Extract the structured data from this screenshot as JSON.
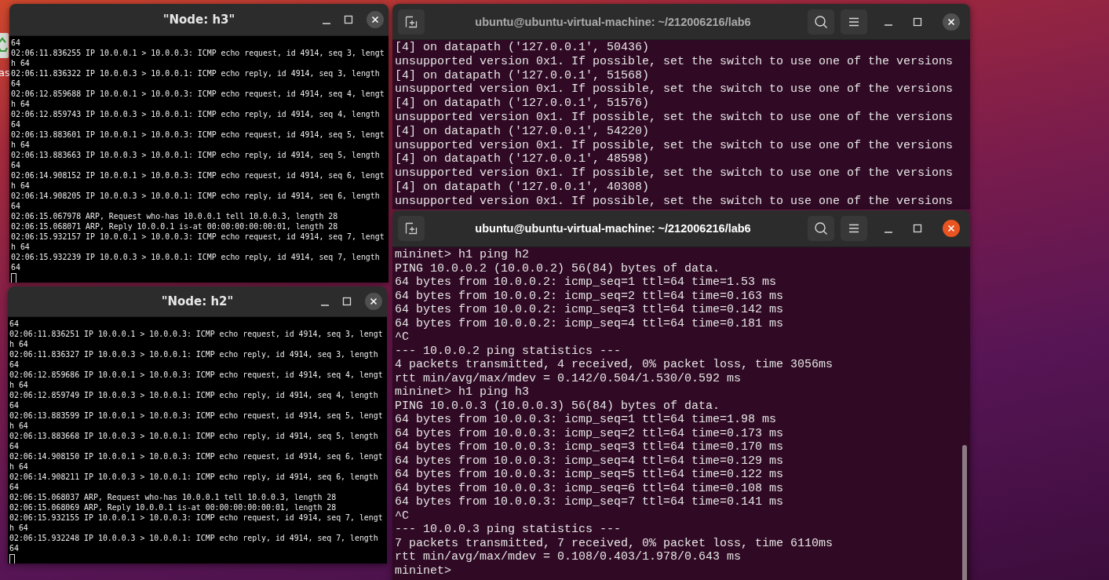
{
  "desktop": {
    "icon_label": "as"
  },
  "windows": [
    {
      "kind": "xterm",
      "title": "\"Node: h3\"",
      "active": false,
      "lines": [
        "64",
        "02:06:11.836255 IP 10.0.0.1 > 10.0.0.3: ICMP echo request, id 4914, seq 3, lengt",
        "h 64",
        "02:06:11.836322 IP 10.0.0.3 > 10.0.0.1: ICMP echo reply, id 4914, seq 3, length",
        "64",
        "02:06:12.859688 IP 10.0.0.1 > 10.0.0.3: ICMP echo request, id 4914, seq 4, lengt",
        "h 64",
        "02:06:12.859743 IP 10.0.0.3 > 10.0.0.1: ICMP echo reply, id 4914, seq 4, length",
        "64",
        "02:06:13.883601 IP 10.0.0.1 > 10.0.0.3: ICMP echo request, id 4914, seq 5, lengt",
        "h 64",
        "02:06:13.883663 IP 10.0.0.3 > 10.0.0.1: ICMP echo reply, id 4914, seq 5, length",
        "64",
        "02:06:14.908152 IP 10.0.0.1 > 10.0.0.3: ICMP echo request, id 4914, seq 6, lengt",
        "h 64",
        "02:06:14.908205 IP 10.0.0.3 > 10.0.0.1: ICMP echo reply, id 4914, seq 6, length",
        "64",
        "02:06:15.067978 ARP, Request who-has 10.0.0.1 tell 10.0.0.3, length 28",
        "02:06:15.068071 ARP, Reply 10.0.0.1 is-at 00:00:00:00:00:01, length 28",
        "02:06:15.932157 IP 10.0.0.1 > 10.0.0.3: ICMP echo request, id 4914, seq 7, lengt",
        "h 64",
        "02:06:15.932239 IP 10.0.0.3 > 10.0.0.1: ICMP echo reply, id 4914, seq 7, length",
        "64"
      ]
    },
    {
      "kind": "gnome",
      "title": "ubuntu@ubuntu-virtual-machine: ~/212006216/lab6",
      "active": false,
      "lines": [
        "[4] on datapath ('127.0.0.1', 50436)",
        "unsupported version 0x1. If possible, set the switch to use one of the versions",
        "[4] on datapath ('127.0.0.1', 51568)",
        "unsupported version 0x1. If possible, set the switch to use one of the versions",
        "[4] on datapath ('127.0.0.1', 51576)",
        "unsupported version 0x1. If possible, set the switch to use one of the versions",
        "[4] on datapath ('127.0.0.1', 54220)",
        "unsupported version 0x1. If possible, set the switch to use one of the versions",
        "[4] on datapath ('127.0.0.1', 48598)",
        "unsupported version 0x1. If possible, set the switch to use one of the versions",
        "[4] on datapath ('127.0.0.1', 40308)",
        "unsupported version 0x1. If possible, set the switch to use one of the versions"
      ]
    },
    {
      "kind": "gnome",
      "title": "ubuntu@ubuntu-virtual-machine: ~/212006216/lab6",
      "active": true,
      "lines": [
        "mininet> h1 ping h2",
        "PING 10.0.0.2 (10.0.0.2) 56(84) bytes of data.",
        "64 bytes from 10.0.0.2: icmp_seq=1 ttl=64 time=1.53 ms",
        "64 bytes from 10.0.0.2: icmp_seq=2 ttl=64 time=0.163 ms",
        "64 bytes from 10.0.0.2: icmp_seq=3 ttl=64 time=0.142 ms",
        "64 bytes from 10.0.0.2: icmp_seq=4 ttl=64 time=0.181 ms",
        "^C",
        "--- 10.0.0.2 ping statistics ---",
        "4 packets transmitted, 4 received, 0% packet loss, time 3056ms",
        "rtt min/avg/max/mdev = 0.142/0.504/1.530/0.592 ms",
        "mininet> h1 ping h3",
        "PING 10.0.0.3 (10.0.0.3) 56(84) bytes of data.",
        "64 bytes from 10.0.0.3: icmp_seq=1 ttl=64 time=1.98 ms",
        "64 bytes from 10.0.0.3: icmp_seq=2 ttl=64 time=0.173 ms",
        "64 bytes from 10.0.0.3: icmp_seq=3 ttl=64 time=0.170 ms",
        "64 bytes from 10.0.0.3: icmp_seq=4 ttl=64 time=0.129 ms",
        "64 bytes from 10.0.0.3: icmp_seq=5 ttl=64 time=0.122 ms",
        "64 bytes from 10.0.0.3: icmp_seq=6 ttl=64 time=0.108 ms",
        "64 bytes from 10.0.0.3: icmp_seq=7 ttl=64 time=0.141 ms",
        "^C",
        "--- 10.0.0.3 ping statistics ---",
        "7 packets transmitted, 7 received, 0% packet loss, time 6110ms",
        "rtt min/avg/max/mdev = 0.108/0.403/1.978/0.643 ms",
        "mininet>"
      ]
    },
    {
      "kind": "xterm",
      "title": "\"Node: h2\"",
      "active": false,
      "lines": [
        "64",
        "02:06:11.836251 IP 10.0.0.1 > 10.0.0.3: ICMP echo request, id 4914, seq 3, lengt",
        "h 64",
        "02:06:11.836327 IP 10.0.0.3 > 10.0.0.1: ICMP echo reply, id 4914, seq 3, length",
        "64",
        "02:06:12.859686 IP 10.0.0.1 > 10.0.0.3: ICMP echo request, id 4914, seq 4, lengt",
        "h 64",
        "02:06:12.859749 IP 10.0.0.3 > 10.0.0.1: ICMP echo reply, id 4914, seq 4, length",
        "64",
        "02:06:13.883599 IP 10.0.0.1 > 10.0.0.3: ICMP echo request, id 4914, seq 5, lengt",
        "h 64",
        "02:06:13.883668 IP 10.0.0.3 > 10.0.0.1: ICMP echo reply, id 4914, seq 5, length",
        "64",
        "02:06:14.908150 IP 10.0.0.1 > 10.0.0.3: ICMP echo request, id 4914, seq 6, lengt",
        "h 64",
        "02:06:14.908211 IP 10.0.0.3 > 10.0.0.1: ICMP echo reply, id 4914, seq 6, length",
        "64",
        "02:06:15.068037 ARP, Request who-has 10.0.0.1 tell 10.0.0.3, length 28",
        "02:06:15.068069 ARP, Reply 10.0.0.1 is-at 00:00:00:00:00:01, length 28",
        "02:06:15.932155 IP 10.0.0.1 > 10.0.0.3: ICMP echo request, id 4914, seq 7, lengt",
        "h 64",
        "02:06:15.932248 IP 10.0.0.3 > 10.0.0.1: ICMP echo reply, id 4914, seq 7, length",
        "64"
      ]
    }
  ]
}
